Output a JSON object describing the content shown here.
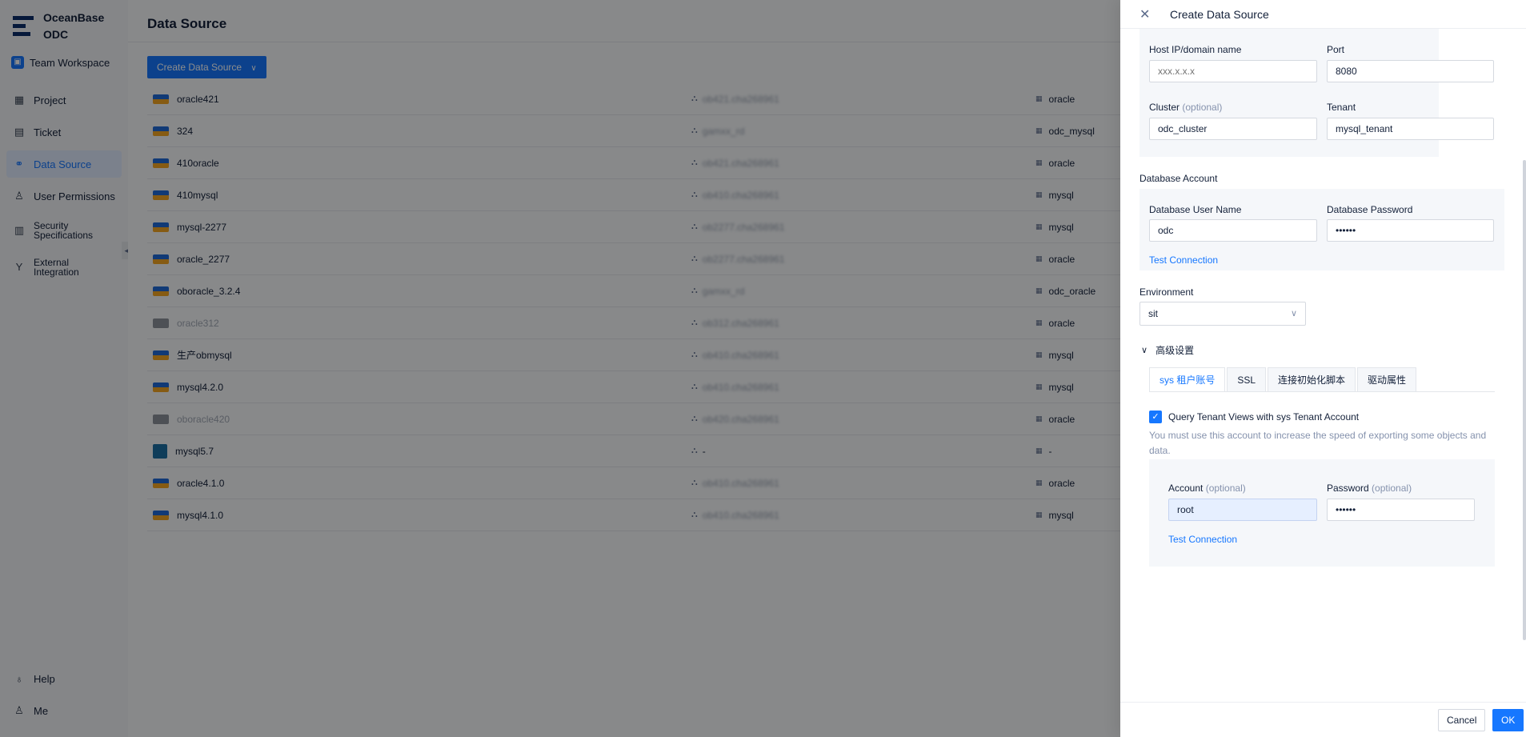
{
  "app": {
    "brand_line1": "OceanBase",
    "brand_line2": "ODC",
    "workspace": "Team Workspace"
  },
  "sidebar": {
    "items": [
      {
        "label": "Project",
        "icon": "project-icon"
      },
      {
        "label": "Ticket",
        "icon": "ticket-icon"
      },
      {
        "label": "Data Source",
        "icon": "link-icon",
        "active": true
      },
      {
        "label": "User Permissions",
        "icon": "user-icon"
      },
      {
        "label": "Security Specifications",
        "icon": "shield-icon"
      },
      {
        "label": "External Integration",
        "icon": "integration-icon"
      }
    ],
    "help": "Help",
    "me": "Me"
  },
  "main": {
    "title": "Data Source",
    "create_button": "Create Data Source",
    "rows": [
      {
        "name": "oracle421",
        "cluster": "ob421.cha268961",
        "type": "oracle"
      },
      {
        "name": "324",
        "cluster": "gamxx_rd",
        "type": "odc_mysql"
      },
      {
        "name": "410oracle",
        "cluster": "ob421.cha268961",
        "type": "oracle"
      },
      {
        "name": "410mysql",
        "cluster": "ob410.cha268961",
        "type": "mysql"
      },
      {
        "name": "mysql-2277",
        "cluster": "ob2277.cha268961",
        "type": "mysql"
      },
      {
        "name": "oracle_2277",
        "cluster": "ob2277.cha268961",
        "type": "oracle"
      },
      {
        "name": "oboracle_3.2.4",
        "cluster": "gamxx_rd",
        "type": "odc_oracle"
      },
      {
        "name": "oracle312",
        "cluster": "ob312.cha268961",
        "type": "oracle",
        "disabled": true
      },
      {
        "name": "生产obmysql",
        "cluster": "ob410.cha268961",
        "type": "mysql"
      },
      {
        "name": "mysql4.2.0",
        "cluster": "ob410.cha268961",
        "type": "mysql"
      },
      {
        "name": "oboracle420",
        "cluster": "ob420.cha268961",
        "type": "oracle",
        "disabled": true
      },
      {
        "name": "mysql5.7",
        "cluster": "-",
        "type": "-"
      },
      {
        "name": "oracle4.1.0",
        "cluster": "ob410.cha268961",
        "type": "oracle"
      },
      {
        "name": "mysql4.1.0",
        "cluster": "ob410.cha268961",
        "type": "mysql"
      }
    ]
  },
  "drawer": {
    "title": "Create Data Source",
    "host_label": "Host IP/domain name",
    "host_placeholder": "xxx.x.x.x",
    "port_label": "Port",
    "port_value": "8080",
    "cluster_label": "Cluster",
    "optional": "(optional)",
    "cluster_value": "odc_cluster",
    "tenant_label": "Tenant",
    "tenant_value": "mysql_tenant",
    "db_account_section": "Database Account",
    "db_user_label": "Database User Name",
    "db_user_value": "odc",
    "db_pass_label": "Database Password",
    "db_pass_value": "••••••",
    "test_connection": "Test Connection",
    "env_label": "Environment",
    "env_value": "sit",
    "advanced": "高级设置",
    "tabs": [
      "sys 租户账号",
      "SSL",
      "连接初始化脚本",
      "驱动属性"
    ],
    "sys_check_label": "Query Tenant Views with sys Tenant Account",
    "sys_hint": "You must use this account to increase the speed of exporting some objects and data.",
    "account_label": "Account",
    "account_value": "root",
    "password_label": "Password",
    "password_value": "••••••",
    "cancel": "Cancel",
    "ok": "OK"
  },
  "colors": {
    "accent": "#1677ff",
    "overlay": "rgba(0,0,0,0.45)"
  }
}
